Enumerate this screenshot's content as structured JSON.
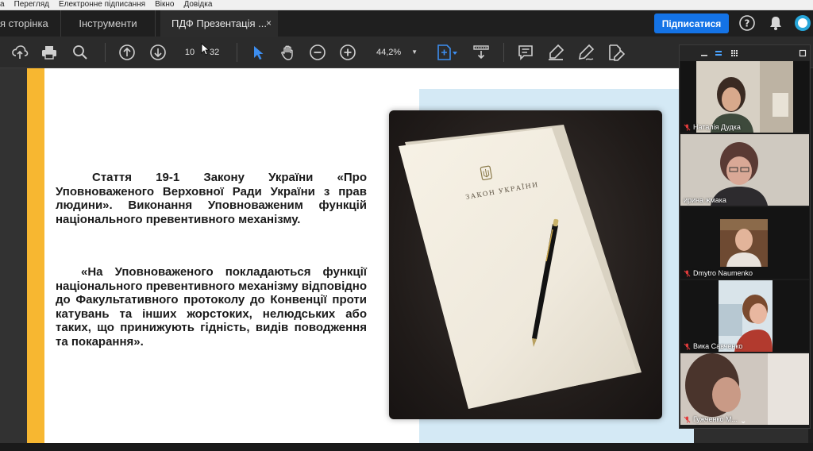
{
  "menubar": {
    "items": [
      "а",
      "Перегляд",
      "Електронне підписання",
      "Вікно",
      "Довідка"
    ]
  },
  "tabs": {
    "home": "я сторінка",
    "tools": "Інструменти",
    "document": "ПДФ Презентація ...",
    "close_glyph": "×"
  },
  "header": {
    "sign_label": "Підписатися"
  },
  "toolbar": {
    "current_page": "10",
    "total_pages": "32",
    "zoom": "44,2%",
    "zoom_caret": "▼",
    "icons": [
      "upload-icon",
      "print-icon",
      "find-icon",
      "page-up-icon",
      "page-down-icon",
      "select-cursor-icon",
      "hand-tool-icon",
      "zoom-out-icon",
      "zoom-in-icon",
      "page-fit-icon",
      "scroll-mode-icon",
      "comment-icon",
      "highlight-icon",
      "sign-icon",
      "edit-pdf-icon"
    ]
  },
  "document": {
    "paragraph1": "Стаття 19-1 Закону України «Про Уповноваженого Верховної Ради України з прав людини». Виконання Уповноваженим функцій національного превентивного механізму.",
    "paragraph2": "«На Уповноваженого покладаються функції національного превентивного механізму відповідно до Факультативного протоколу до Конвенції проти катувань та інших жорстоких, нелюдських або таких, що принижують гідність, видів поводження та покарання».",
    "photo_caption": "ЗАКОН УКРАЇНИ",
    "colors": {
      "accent_bar": "#f7b731",
      "blue_block": "#d4e9f5"
    }
  },
  "video_panel": {
    "participants": [
      {
        "name": "Наталія Дудка",
        "muted": true,
        "active": false
      },
      {
        "name": "ирина жмака",
        "muted": false,
        "active": true
      },
      {
        "name": "Dmytro Naumenko",
        "muted": true,
        "active": false
      },
      {
        "name": "Вика Савченко",
        "muted": true,
        "active": false
      },
      {
        "name": "Гужченко М...",
        "muted": true,
        "active": false
      }
    ],
    "chevron": "⌄"
  }
}
